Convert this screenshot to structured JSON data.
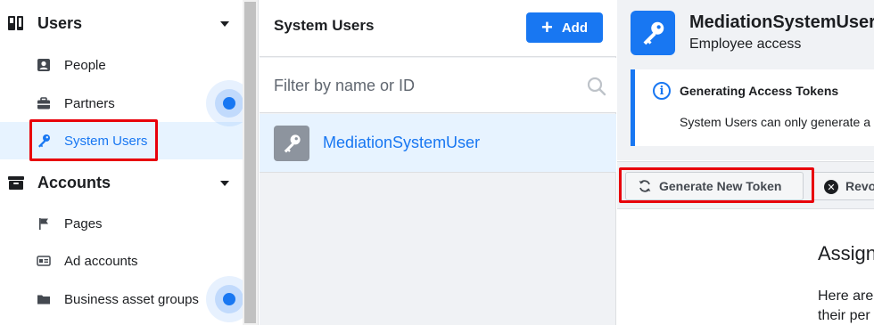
{
  "sidebar": {
    "users_section": {
      "label": "Users",
      "icon": "users-icon"
    },
    "users_items": [
      {
        "label": "People",
        "icon": "person-card-icon"
      },
      {
        "label": "Partners",
        "icon": "briefcase-icon"
      },
      {
        "label": "System Users",
        "icon": "key-icon",
        "active": true
      }
    ],
    "accounts_section": {
      "label": "Accounts",
      "icon": "archive-box-icon"
    },
    "accounts_items": [
      {
        "label": "Pages",
        "icon": "flag-icon"
      },
      {
        "label": "Ad accounts",
        "icon": "ad-card-icon"
      },
      {
        "label": "Business asset groups",
        "icon": "folder-icon"
      }
    ]
  },
  "middle": {
    "title": "System Users",
    "add_button": {
      "label": "Add",
      "icon": "plus-icon"
    },
    "search": {
      "placeholder": "Filter by name or ID",
      "value": ""
    },
    "users": [
      {
        "name": "MediationSystemUser",
        "icon": "key-icon"
      }
    ]
  },
  "detail": {
    "name": "MediationSystemUser",
    "role": "Employee access",
    "info": {
      "title": "Generating Access Tokens",
      "text": "System Users can only generate a"
    },
    "actions": {
      "generate_label": "Generate New Token",
      "revoke_label": "Revo"
    },
    "assign_title": "Assign",
    "assign_text_line1": "Here are",
    "assign_text_line2": "their per"
  },
  "colors": {
    "accent": "#1877f2",
    "highlight": "#e8000b",
    "active_bg": "#e7f3ff"
  }
}
